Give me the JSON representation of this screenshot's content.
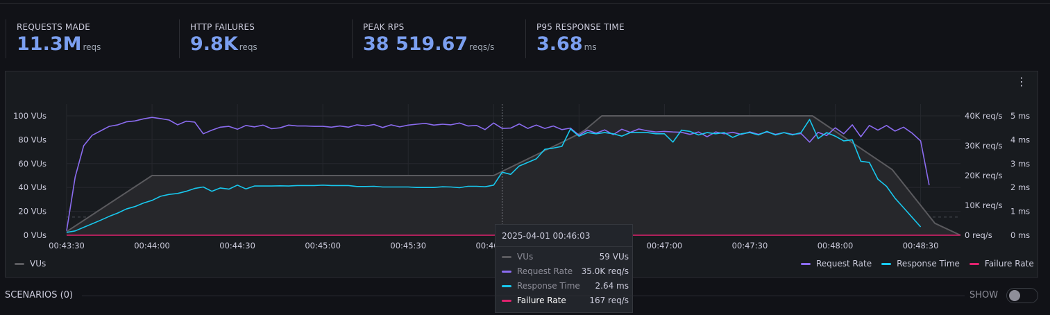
{
  "stats": [
    {
      "label": "REQUESTS MADE",
      "value": "11.3M",
      "unit": "reqs"
    },
    {
      "label": "HTTP FAILURES",
      "value": "9.8K",
      "unit": "reqs"
    },
    {
      "label": "PEAK RPS",
      "value": "38 519.67",
      "unit": "reqs/s"
    },
    {
      "label": "P95 RESPONSE TIME",
      "value": "3.68",
      "unit": "ms"
    }
  ],
  "panel": {
    "menu_icon": "kebab-menu-icon"
  },
  "colors": {
    "vus": "#5a5a5e",
    "request_rate": "#8b6cf0",
    "response_time": "#18c8ee",
    "failure_rate": "#e0226e",
    "stat_value": "#7b9ff0"
  },
  "legend": {
    "vus": "VUs",
    "request_rate": "Request Rate",
    "response_time": "Response Time",
    "failure_rate": "Failure Rate"
  },
  "tooltip": {
    "time": "2025-04-01 00:46:03",
    "rows": [
      {
        "name": "VUs",
        "value": "59 VUs"
      },
      {
        "name": "Request Rate",
        "value": "35.0K req/s"
      },
      {
        "name": "Response Time",
        "value": "2.64 ms"
      },
      {
        "name": "Failure Rate",
        "value": "167 req/s"
      }
    ]
  },
  "scenarios": {
    "label": "SCENARIOS (0)",
    "show_label": "SHOW",
    "show_enabled": false
  },
  "chart_data": {
    "type": "line",
    "x_ticks": [
      "00:43:30",
      "00:44:00",
      "00:44:30",
      "00:45:00",
      "00:45:30",
      "00:46:00",
      "00:46:30",
      "00:47:00",
      "00:47:30",
      "00:48:00",
      "00:48:30"
    ],
    "x_start_seconds": 30,
    "x_end_seconds": 344,
    "x_tick_step_seconds": 30,
    "hover_seconds": 183,
    "y_left": {
      "ticks": [
        "0 VUs",
        "20 VUs",
        "40 VUs",
        "60 VUs",
        "80 VUs",
        "100 VUs"
      ],
      "range": [
        0,
        100
      ],
      "unit": "VUs"
    },
    "y_right1": {
      "ticks": [
        "0 req/s",
        "10K req/s",
        "20K req/s",
        "30K req/s",
        "40K req/s"
      ],
      "range": [
        0,
        40000
      ],
      "unit": "req/s"
    },
    "y_right2": {
      "ticks": [
        "0 ms",
        "1 ms",
        "2 ms",
        "3 ms",
        "4 ms",
        "5 ms"
      ],
      "range": [
        0,
        5
      ],
      "unit": "ms"
    },
    "threshold_ms": 0.76,
    "series": [
      {
        "name": "VUs",
        "axis": "left",
        "points": [
          [
            30,
            3
          ],
          [
            60,
            50
          ],
          [
            90,
            50
          ],
          [
            180,
            50
          ],
          [
            210,
            85
          ],
          [
            205,
            79
          ],
          [
            212,
            88
          ],
          [
            218,
            100
          ],
          [
            292,
            100
          ],
          [
            320,
            55
          ],
          [
            335,
            10
          ],
          [
            344,
            0
          ]
        ]
      },
      {
        "name": "Request Rate",
        "axis": "right1",
        "points": [
          [
            30,
            1500
          ],
          [
            33,
            19500
          ],
          [
            36,
            30000
          ],
          [
            39,
            33500
          ],
          [
            42,
            35000
          ],
          [
            45,
            36500
          ],
          [
            48,
            37000
          ],
          [
            51,
            38000
          ],
          [
            54,
            38300
          ],
          [
            57,
            39000
          ],
          [
            60,
            39500
          ],
          [
            63,
            39100
          ],
          [
            66,
            38600
          ],
          [
            69,
            37000
          ],
          [
            72,
            38200
          ],
          [
            75,
            37900
          ],
          [
            78,
            34000
          ],
          [
            81,
            35200
          ],
          [
            84,
            36200
          ],
          [
            87,
            36500
          ],
          [
            90,
            35500
          ],
          [
            93,
            36800
          ],
          [
            96,
            36300
          ],
          [
            99,
            36900
          ],
          [
            102,
            35700
          ],
          [
            105,
            36000
          ],
          [
            108,
            36900
          ],
          [
            111,
            36600
          ],
          [
            114,
            36600
          ],
          [
            117,
            36500
          ],
          [
            120,
            36500
          ],
          [
            123,
            36200
          ],
          [
            126,
            36600
          ],
          [
            129,
            36200
          ],
          [
            132,
            37000
          ],
          [
            135,
            36600
          ],
          [
            138,
            37100
          ],
          [
            141,
            36100
          ],
          [
            144,
            37000
          ],
          [
            147,
            36300
          ],
          [
            150,
            36900
          ],
          [
            153,
            37200
          ],
          [
            156,
            37500
          ],
          [
            159,
            36900
          ],
          [
            162,
            37200
          ],
          [
            165,
            37000
          ],
          [
            168,
            37600
          ],
          [
            171,
            36600
          ],
          [
            174,
            36800
          ],
          [
            177,
            35400
          ],
          [
            180,
            37600
          ],
          [
            183,
            35800
          ],
          [
            186,
            35900
          ],
          [
            189,
            37300
          ],
          [
            192,
            35800
          ],
          [
            195,
            36900
          ],
          [
            198,
            35800
          ],
          [
            201,
            36600
          ],
          [
            204,
            35400
          ],
          [
            207,
            35900
          ],
          [
            210,
            33500
          ],
          [
            213,
            35200
          ],
          [
            216,
            34200
          ],
          [
            219,
            35300
          ],
          [
            222,
            33700
          ],
          [
            225,
            35500
          ],
          [
            228,
            34500
          ],
          [
            231,
            35600
          ],
          [
            234,
            35000
          ],
          [
            237,
            34600
          ],
          [
            240,
            34800
          ],
          [
            243,
            34600
          ],
          [
            246,
            34500
          ],
          [
            249,
            33800
          ],
          [
            252,
            34600
          ],
          [
            255,
            33000
          ],
          [
            258,
            34600
          ],
          [
            261,
            34000
          ],
          [
            264,
            34500
          ],
          [
            267,
            33800
          ],
          [
            270,
            34600
          ],
          [
            273,
            33800
          ],
          [
            276,
            34600
          ],
          [
            279,
            33800
          ],
          [
            282,
            34400
          ],
          [
            285,
            33800
          ],
          [
            288,
            34100
          ],
          [
            291,
            31200
          ],
          [
            294,
            34500
          ],
          [
            297,
            33400
          ],
          [
            300,
            36000
          ],
          [
            303,
            34000
          ],
          [
            306,
            37000
          ],
          [
            309,
            33000
          ],
          [
            312,
            36800
          ],
          [
            315,
            35200
          ],
          [
            318,
            36800
          ],
          [
            321,
            34900
          ],
          [
            324,
            36200
          ],
          [
            327,
            34200
          ],
          [
            330,
            31600
          ],
          [
            333,
            16800
          ]
        ]
      },
      {
        "name": "Response Time",
        "axis": "right2",
        "points": [
          [
            30,
            0.12
          ],
          [
            33,
            0.18
          ],
          [
            36,
            0.33
          ],
          [
            39,
            0.48
          ],
          [
            42,
            0.63
          ],
          [
            45,
            0.79
          ],
          [
            48,
            0.93
          ],
          [
            51,
            1.1
          ],
          [
            54,
            1.2
          ],
          [
            57,
            1.35
          ],
          [
            60,
            1.46
          ],
          [
            63,
            1.63
          ],
          [
            66,
            1.71
          ],
          [
            69,
            1.75
          ],
          [
            72,
            1.84
          ],
          [
            75,
            1.96
          ],
          [
            78,
            2.02
          ],
          [
            81,
            1.84
          ],
          [
            84,
            1.98
          ],
          [
            87,
            1.93
          ],
          [
            90,
            2.1
          ],
          [
            93,
            1.94
          ],
          [
            96,
            2.06
          ],
          [
            99,
            2.06
          ],
          [
            102,
            2.06
          ],
          [
            105,
            2.07
          ],
          [
            108,
            2.06
          ],
          [
            111,
            2.08
          ],
          [
            114,
            2.08
          ],
          [
            117,
            2.08
          ],
          [
            120,
            2.1
          ],
          [
            123,
            2.08
          ],
          [
            126,
            2.08
          ],
          [
            129,
            2.08
          ],
          [
            132,
            2.04
          ],
          [
            135,
            2.04
          ],
          [
            138,
            2.05
          ],
          [
            141,
            2.02
          ],
          [
            144,
            2.02
          ],
          [
            147,
            2.02
          ],
          [
            150,
            2.02
          ],
          [
            153,
            2.0
          ],
          [
            156,
            2.0
          ],
          [
            159,
            2.0
          ],
          [
            162,
            2.03
          ],
          [
            165,
            2.02
          ],
          [
            168,
            1.99
          ],
          [
            171,
            2.05
          ],
          [
            174,
            2.05
          ],
          [
            177,
            2.03
          ],
          [
            180,
            2.1
          ],
          [
            183,
            2.64
          ],
          [
            186,
            2.55
          ],
          [
            189,
            2.9
          ],
          [
            192,
            3.05
          ],
          [
            195,
            3.2
          ],
          [
            198,
            3.6
          ],
          [
            201,
            3.65
          ],
          [
            204,
            3.72
          ],
          [
            207,
            4.45
          ],
          [
            210,
            4.15
          ],
          [
            213,
            4.3
          ],
          [
            216,
            4.25
          ],
          [
            219,
            4.3
          ],
          [
            222,
            4.25
          ],
          [
            225,
            4.15
          ],
          [
            228,
            4.3
          ],
          [
            231,
            4.3
          ],
          [
            234,
            4.3
          ],
          [
            237,
            4.25
          ],
          [
            240,
            4.25
          ],
          [
            243,
            3.9
          ],
          [
            246,
            4.4
          ],
          [
            249,
            4.35
          ],
          [
            252,
            4.2
          ],
          [
            255,
            4.3
          ],
          [
            258,
            4.25
          ],
          [
            261,
            4.3
          ],
          [
            264,
            4.1
          ],
          [
            267,
            4.25
          ],
          [
            270,
            4.3
          ],
          [
            273,
            4.2
          ],
          [
            276,
            4.35
          ],
          [
            279,
            4.2
          ],
          [
            282,
            4.3
          ],
          [
            285,
            4.2
          ],
          [
            288,
            4.3
          ],
          [
            291,
            4.85
          ],
          [
            294,
            4.05
          ],
          [
            297,
            4.3
          ],
          [
            300,
            4.15
          ],
          [
            303,
            3.95
          ],
          [
            306,
            4.0
          ],
          [
            309,
            3.1
          ],
          [
            312,
            3.05
          ],
          [
            315,
            2.35
          ],
          [
            318,
            2.05
          ],
          [
            321,
            1.55
          ],
          [
            324,
            1.15
          ],
          [
            327,
            0.75
          ],
          [
            330,
            0.35
          ]
        ]
      },
      {
        "name": "Failure Rate",
        "axis": "right1",
        "points": [
          [
            30,
            0
          ],
          [
            60,
            0
          ],
          [
            180,
            0
          ],
          [
            183,
            167
          ],
          [
            190,
            0
          ],
          [
            344,
            0
          ]
        ]
      }
    ]
  }
}
